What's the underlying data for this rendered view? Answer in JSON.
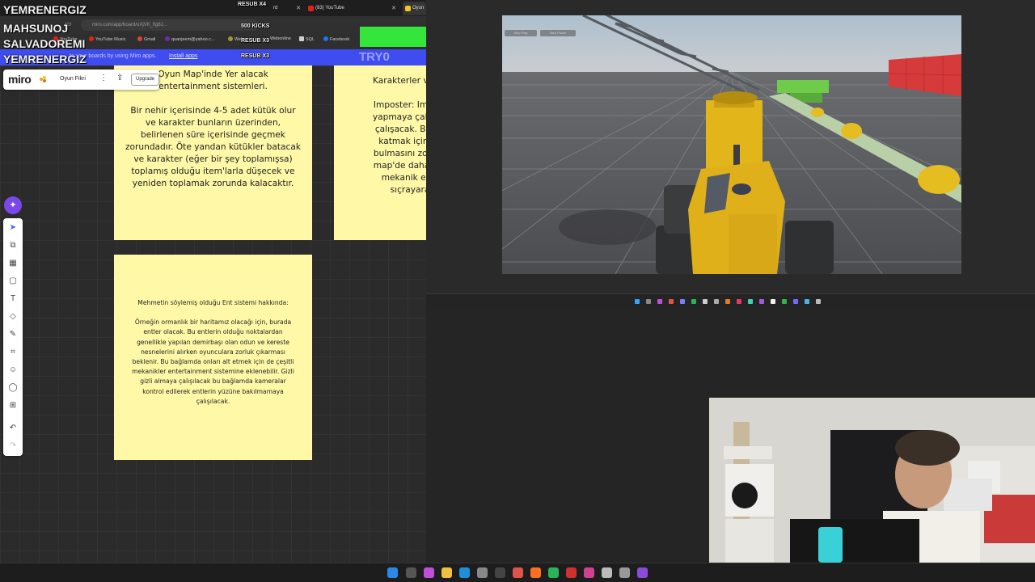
{
  "stream_overlay": {
    "name_top": "YEMRENERGIZ",
    "resub_x4": "RESUB X4",
    "kicks": "500 KICKS",
    "name_2": "MAHSUNOJ",
    "name_3": "SALVADOREMI",
    "resub_x3a": "RESUB X3",
    "name_4": "YEMRENERGIZ",
    "resub_x3b": "RESUB X3",
    "try_label": "TRY0"
  },
  "browser": {
    "tabs": [
      {
        "label": "rd",
        "color": "#888888"
      },
      {
        "label": "(83) YouTube",
        "color": "#e62117"
      },
      {
        "label": "Oyun",
        "color": "#f5c518"
      }
    ],
    "address": "miro.com/app/board/uXjVK_fig8J...",
    "bookmarks": [
      "YouTube",
      "YouTube Music",
      "Gmail",
      "quanjeem@yahoo.c...",
      "Web",
      "Webonline",
      "SQL",
      "Facebook"
    ]
  },
  "miro": {
    "banner_hint": "to your boards by using Miro apps.",
    "install_link": "Install apps",
    "logo": "miro",
    "board_name": "Oyun Fikri",
    "upgrade_label": "Upgrade",
    "brand_color": "#ffd02f",
    "tools": [
      "cursor-icon",
      "template-icon",
      "table-icon",
      "sticky-note-icon",
      "text-icon",
      "shapes-icon",
      "pen-icon",
      "frame-icon",
      "emoji-icon",
      "comment-icon",
      "add-icon",
      "undo-icon",
      "redo-icon"
    ],
    "sticky1": {
      "title_lines": [
        "Oyun Map'inde Yer alacak",
        "entertainment sistemleri."
      ],
      "body": "Bir nehir içerisinde 4-5 adet kütük olur ve karakter bunların üzerinden, belirlenen süre içerisinde geçmek zorundadır. Öte yandan kütükler batacak ve karakter (eğer bir şey toplamışsa) toplamış olduğu item'larla düşecek ve yeniden toplamak zorunda kalacaktır."
    },
    "sticky2": {
      "lines": [
        "Karakterler ve Ro",
        "",
        "Imposter: Impost",
        "yapmaya çalıştıkl",
        "çalışacak. Bu rol",
        "katmak için ve",
        "bulmasını zorlaşt",
        "map'de daha rah",
        "mekanik ekle",
        "sıçrayara"
      ]
    },
    "sticky3": {
      "title": "Mehmetin söylemiş olduğu Ent sistemi hakkında:",
      "body": "Örneğin ormanlık bir haritamız olacağı için, burada entler olacak. Bu entlerin olduğu noktalardan genellikle yapılan demirbaşı olan odun ve kereste nesnelerini alırken oyunculara zorluk çıkarması beklenir. Bu bağlamda onları alt etmek için de çeşitli mekanikler entertainment sistemine eklenebilir. Gizli gizli almaya çalışılacak bu bağlamda kameralar kontrol edilerek entlerin yüzüne bakılmamaya çalışılacak."
    }
  },
  "unity": {
    "btn_a": "Step Play",
    "btn_b": "Step Pause"
  },
  "colors": {
    "sticky_yellow": "#fff9a7",
    "green_block": "#34e63b",
    "banner_blue": "#3f4cf0"
  }
}
